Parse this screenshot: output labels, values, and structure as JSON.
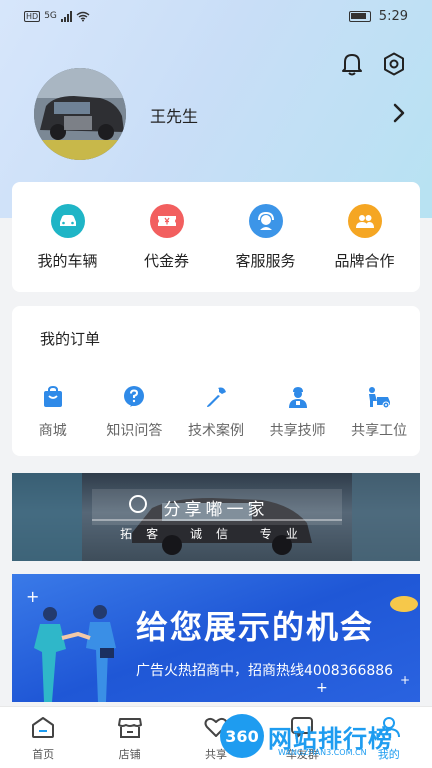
{
  "status_bar": {
    "time": "5:29",
    "network": "5G"
  },
  "profile": {
    "name": "王先生"
  },
  "quick_actions": [
    {
      "label": "我的车辆",
      "icon": "car-icon",
      "color": "#1fb5c6"
    },
    {
      "label": "代金券",
      "icon": "coupon-icon",
      "color": "#f25f5f"
    },
    {
      "label": "客服服务",
      "icon": "customer-service-icon",
      "color": "#3c95e8"
    },
    {
      "label": "品牌合作",
      "icon": "partnership-icon",
      "color": "#f5a623"
    }
  ],
  "orders": {
    "title": "我的订单",
    "items": [
      {
        "label": "商城",
        "icon": "shopping-bag-icon"
      },
      {
        "label": "知识问答",
        "icon": "question-icon"
      },
      {
        "label": "技术案例",
        "icon": "wrench-icon"
      },
      {
        "label": "共享技师",
        "icon": "technician-icon"
      },
      {
        "label": "共享工位",
        "icon": "workstation-icon"
      }
    ],
    "icon_color": "#2f8ae8"
  },
  "banner1": {
    "title": "分享嘟一家",
    "subtitle": "拓客 诚信 专业"
  },
  "banner2": {
    "title": "给您展示的机会",
    "subtitle": "广告火热招商中，招商热线4008366886"
  },
  "tabs": [
    {
      "label": "首页",
      "icon": "home-icon"
    },
    {
      "label": "店铺",
      "icon": "store-icon"
    },
    {
      "label": "共享",
      "icon": "heart-icon"
    },
    {
      "label": "车友群",
      "icon": "chat-icon"
    },
    {
      "label": "我的",
      "icon": "user-icon"
    }
  ],
  "watermark": {
    "logo": "360",
    "text": "网站排行榜",
    "sub": "WANGZHAN3.COM.CN"
  }
}
